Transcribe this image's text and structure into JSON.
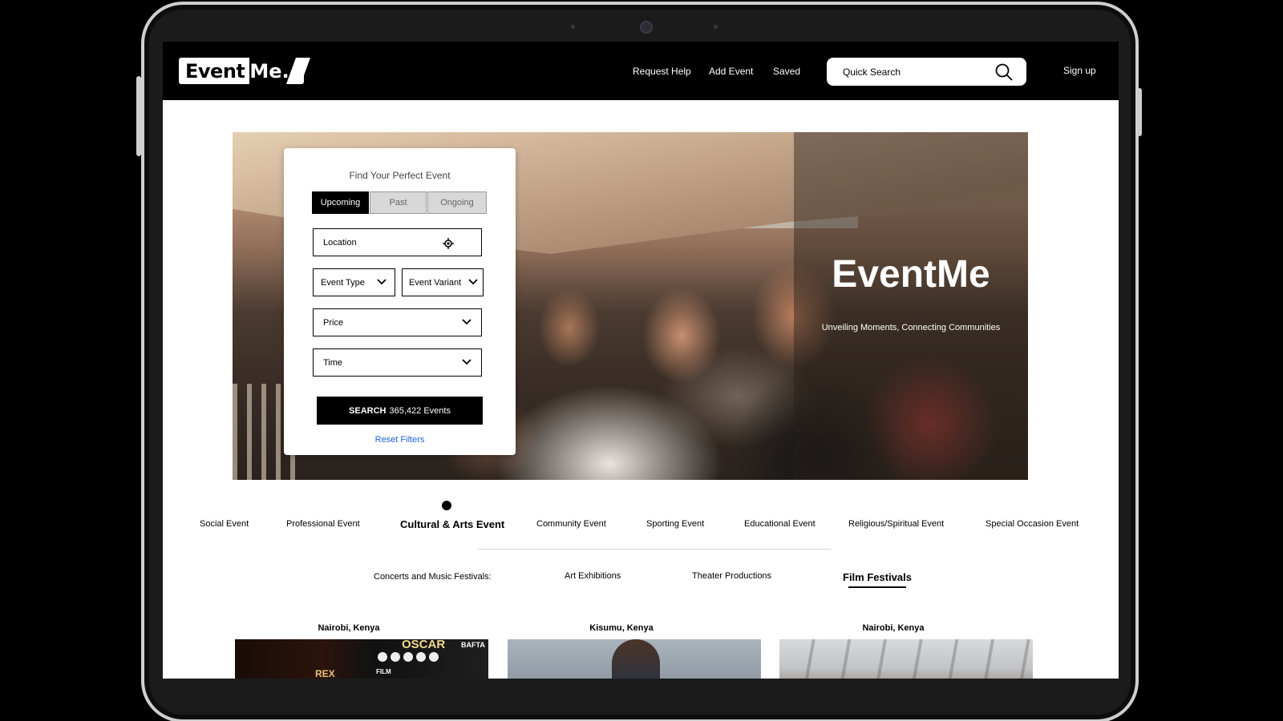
{
  "brand": {
    "left": "Event",
    "right": "Me."
  },
  "nav": {
    "request_help": "Request Help",
    "add_event": "Add Event",
    "saved": "Saved",
    "sign_up": "Sign up"
  },
  "search": {
    "placeholder": "Quick Search"
  },
  "hero": {
    "title": "EventMe",
    "subtitle": "Unveiling Moments, Connecting Communities"
  },
  "filter": {
    "title": "Find Your Perfect Event",
    "tabs": [
      "Upcoming",
      "Past",
      "Ongoing"
    ],
    "active_tab": "Upcoming",
    "location": "Location",
    "event_type": "Event Type",
    "event_variant": "Event Variant",
    "price": "Price",
    "time": "Time",
    "search_label": "SEARCH",
    "search_count": "365,422 Events",
    "reset": "Reset Filters"
  },
  "categories": [
    "Social Event",
    "Professional Event",
    "Cultural & Arts Event",
    "Community Event",
    "Sporting Event",
    "Educational Event",
    "Religious/Spiritual Event",
    "Special Occasion Event"
  ],
  "active_category": "Cultural & Arts Event",
  "subcategories": [
    "Concerts and Music Festivals:",
    "Art Exhibitions",
    "Theater Productions",
    "Film Festivals"
  ],
  "active_subcategory": "Film Festivals",
  "events": [
    {
      "location": "Nairobi, Kenya",
      "poster_text": [
        "REX",
        "OSCAR",
        "BAFTA",
        "FILM"
      ]
    },
    {
      "location": "Kisumu, Kenya"
    },
    {
      "location": "Nairobi, Kenya"
    }
  ],
  "colors": {
    "accent": "#000000",
    "link": "#1c63d6"
  }
}
